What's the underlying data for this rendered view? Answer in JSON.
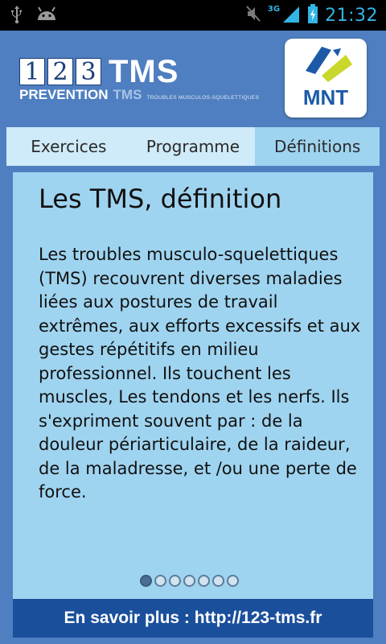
{
  "status_bar": {
    "time": "21:32",
    "network": "3G",
    "icons": [
      "usb-icon",
      "android-icon",
      "mute-icon",
      "signal-icon",
      "battery-charging-icon"
    ]
  },
  "header": {
    "logo": {
      "digits": [
        "1",
        "2",
        "3"
      ],
      "word": "TMS",
      "prevention": "PREVENTION",
      "tms_small": "TMS",
      "tagline": "TROUBLES MUSCULOS-SQUELETTIQUES"
    },
    "partner_logo": {
      "text": "MNT"
    }
  },
  "tabs": [
    {
      "label": "Exercices",
      "active": false
    },
    {
      "label": "Programme",
      "active": false
    },
    {
      "label": "Définitions",
      "active": true
    }
  ],
  "content": {
    "title": "Les TMS, définition",
    "text": "Les troubles musculo-squelettiques (TMS) recouvrent diverses maladies liées aux postures de travail extrêmes, aux efforts excessifs et aux gestes répétitifs en milieu professionnel. Ils touchent les muscles, Les tendons  et les nerfs. Ils s'expriment souvent par : de la douleur périarticulaire, de la raideur, de la maladresse, et /ou une perte de force."
  },
  "pager": {
    "count": 7,
    "active_index": 0
  },
  "footer": {
    "link_text": "En savoir plus : http://123-tms.fr"
  },
  "colors": {
    "background": "#4f7fc0",
    "tab_bar": "#cfeaf8",
    "active_tab": "#9fd4f0",
    "panel": "#9fd4f0",
    "footer": "#1a4f9c",
    "status_accent": "#33b5e5"
  }
}
